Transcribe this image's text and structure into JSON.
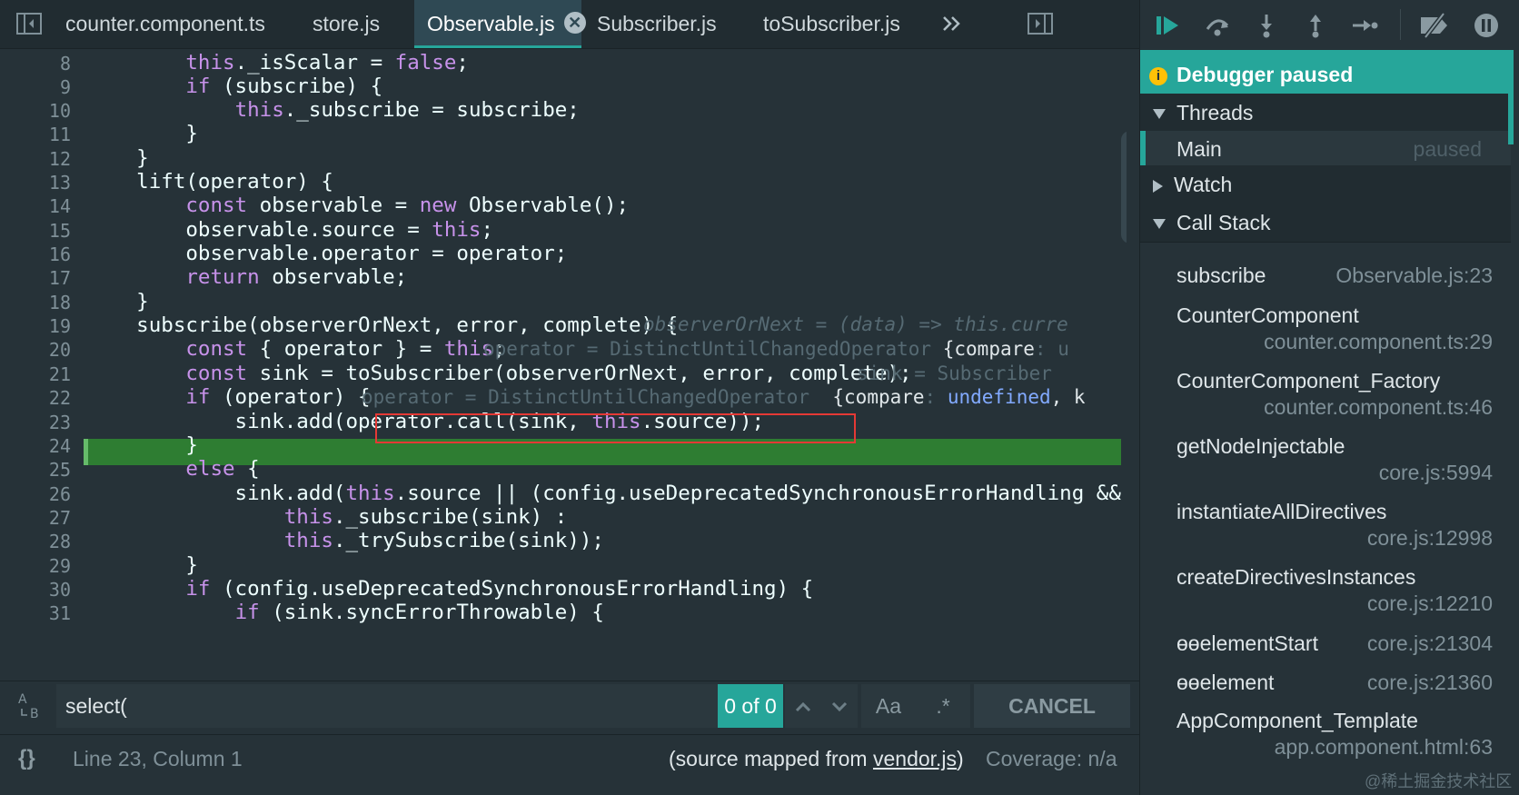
{
  "tabs": {
    "items": [
      {
        "label": "counter.component.ts"
      },
      {
        "label": "store.js"
      },
      {
        "label": "Observable.js",
        "active": true
      },
      {
        "label": "Subscriber.js"
      },
      {
        "label": "toSubscriber.js"
      }
    ],
    "overflow_icon": "chevron-double-right-icon",
    "close_glyph": "✕"
  },
  "editor": {
    "lines": [
      {
        "num": "8",
        "code": "        this._isScalar = false;"
      },
      {
        "num": "9",
        "code": "        if (subscribe) {"
      },
      {
        "num": "10",
        "code": "            this._subscribe = subscribe;"
      },
      {
        "num": "11",
        "code": "        }"
      },
      {
        "num": "12",
        "code": "    }"
      },
      {
        "num": "13",
        "code": "    lift(operator) {"
      },
      {
        "num": "14",
        "code": "        const observable = new Observable();"
      },
      {
        "num": "15",
        "code": "        observable.source = this;"
      },
      {
        "num": "16",
        "code": "        observable.operator = operator;"
      },
      {
        "num": "17",
        "code": "        return observable;"
      },
      {
        "num": "18",
        "code": "    }"
      },
      {
        "num": "19",
        "code": "    subscribe(observerOrNext, error, complete) {"
      },
      {
        "num": "20",
        "code": "        const { operator } = this;"
      },
      {
        "num": "21",
        "code": "        const sink = toSubscriber(observerOrNext, error, complete);"
      },
      {
        "num": "22",
        "code": "        if (operator) {"
      },
      {
        "num": "23",
        "code": "            sink.add(operator.call(sink, this.source));"
      },
      {
        "num": "24",
        "code": "        }"
      },
      {
        "num": "25",
        "code": "        else {"
      },
      {
        "num": "26",
        "code": "            sink.add(this.source || (config.useDeprecatedSynchronousErrorHandling && !s"
      },
      {
        "num": "27",
        "code": "                this._subscribe(sink) :"
      },
      {
        "num": "28",
        "code": "                this._trySubscribe(sink));"
      },
      {
        "num": "29",
        "code": "        }"
      },
      {
        "num": "30",
        "code": "        if (config.useDeprecatedSynchronousErrorHandling) {"
      },
      {
        "num": "31",
        "code": "            if (sink.syncErrorThrowable) {"
      }
    ],
    "inline_values": {
      "line19": "observerOrNext = (data) => this.curre",
      "line20_a": "operator = DistinctUntilChangedOperator",
      "line20_b": "{compare",
      "line20_c": ": u",
      "line21": "sink = Subscriber",
      "line22_a": "operator = DistinctUntilChangedOperator",
      "line22_b": "{compare",
      "line22_c": ": ",
      "line22_d": "undefined",
      "line22_e": ", k"
    }
  },
  "search": {
    "icon": "match-case-toggle-icon",
    "value": "select(",
    "match_count": "0 of 0",
    "prev_icon": "chevron-up-icon",
    "next_icon": "chevron-down-icon",
    "case_label": "Aa",
    "regex_label": ".*",
    "cancel_label": "CANCEL"
  },
  "status": {
    "braces_icon": "{}",
    "position": "Line 23, Column 1",
    "source_prefix": "(source mapped from ",
    "source_link": "vendor.js",
    "source_suffix": ")",
    "coverage": "Coverage: n/a"
  },
  "debugger": {
    "toolbar_icons": [
      "resume-icon",
      "step-over-icon",
      "step-into-icon",
      "step-out-icon",
      "step-icon",
      "deactivate-breakpoints-icon",
      "pause-on-exceptions-icon"
    ],
    "paused_icon": "i",
    "paused_label": "Debugger paused",
    "threads_label": "Threads",
    "thread_name": "Main",
    "thread_state": "paused",
    "watch_label": "Watch",
    "callstack_label": "Call Stack",
    "frames": [
      {
        "name": "subscribe",
        "loc": "Observable.js:23"
      },
      {
        "name": "CounterComponent",
        "loc": "counter.component.ts:29"
      },
      {
        "name": "CounterComponent_Factory",
        "loc": "counter.component.ts:46"
      },
      {
        "name": "getNodeInjectable",
        "loc": "core.js:5994"
      },
      {
        "name": "instantiateAllDirectives",
        "loc": "core.js:12998"
      },
      {
        "name": "createDirectivesInstances",
        "loc": "core.js:12210"
      },
      {
        "name": "ɵɵelementStart",
        "loc": "core.js:21304"
      },
      {
        "name": "ɵɵelement",
        "loc": "core.js:21360"
      },
      {
        "name": "AppComponent_Template",
        "loc": "app.component.html:63"
      }
    ]
  },
  "watermark": "@稀土掘金技术社区",
  "colors": {
    "accent": "#26a69a",
    "current_line": "#2e7d32",
    "highlight_box": "#e53935",
    "keyword": "#c792ea"
  }
}
